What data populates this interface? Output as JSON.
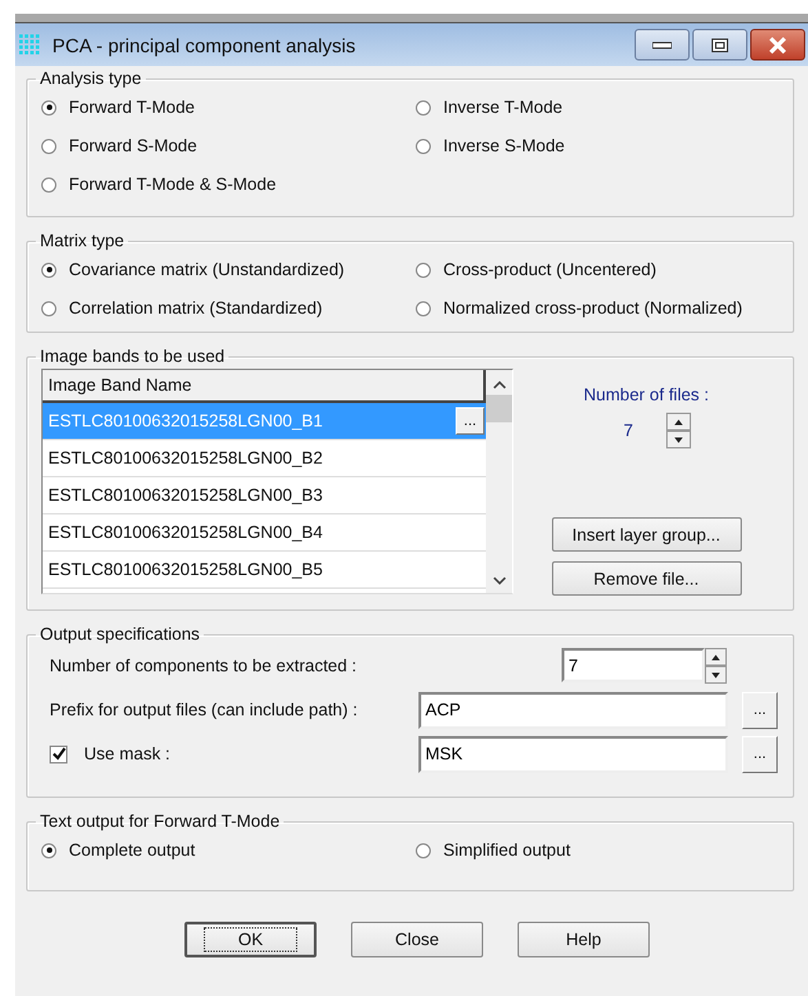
{
  "window": {
    "title": "PCA - principal component analysis"
  },
  "analysis_type": {
    "title": "Analysis type",
    "options": [
      {
        "label": "Forward T-Mode",
        "selected": true
      },
      {
        "label": "Inverse T-Mode",
        "selected": false
      },
      {
        "label": "Forward S-Mode",
        "selected": false
      },
      {
        "label": "Inverse S-Mode",
        "selected": false
      },
      {
        "label": "Forward T-Mode & S-Mode",
        "selected": false
      }
    ]
  },
  "matrix_type": {
    "title": "Matrix type",
    "options": [
      {
        "label": "Covariance matrix (Unstandardized)",
        "selected": true
      },
      {
        "label": "Cross-product (Uncentered)",
        "selected": false
      },
      {
        "label": "Correlation matrix (Standardized)",
        "selected": false
      },
      {
        "label": "Normalized cross-product (Normalized)",
        "selected": false
      }
    ]
  },
  "image_bands": {
    "title": "Image bands to be used",
    "column": "Image Band Name",
    "browse": "...",
    "rows": [
      {
        "name": "ESTLC80100632015258LGN00_B1",
        "selected": true
      },
      {
        "name": "ESTLC80100632015258LGN00_B2",
        "selected": false
      },
      {
        "name": "ESTLC80100632015258LGN00_B3",
        "selected": false
      },
      {
        "name": "ESTLC80100632015258LGN00_B4",
        "selected": false
      },
      {
        "name": "ESTLC80100632015258LGN00_B5",
        "selected": false
      }
    ],
    "files_label": "Number of files :",
    "files_count": "7",
    "buttons": [
      "Insert layer group...",
      "Remove file..."
    ]
  },
  "output": {
    "title": "Output specifications",
    "components_label": "Number of components to be extracted :",
    "components_value": "7",
    "prefix_label": "Prefix for output files (can include path) :",
    "prefix_value": "ACP",
    "prefix_browse": "...",
    "mask": {
      "label": "Use mask :",
      "checked": true
    },
    "mask_value": "MSK",
    "mask_browse": "..."
  },
  "text_output": {
    "title": "Text output for Forward T-Mode",
    "options": [
      {
        "label": "Complete output",
        "selected": true
      },
      {
        "label": "Simplified output",
        "selected": false
      }
    ]
  },
  "buttons": [
    {
      "label": "OK",
      "focused": true
    },
    {
      "label": "Close",
      "focused": false
    },
    {
      "label": "Help",
      "focused": false
    }
  ]
}
